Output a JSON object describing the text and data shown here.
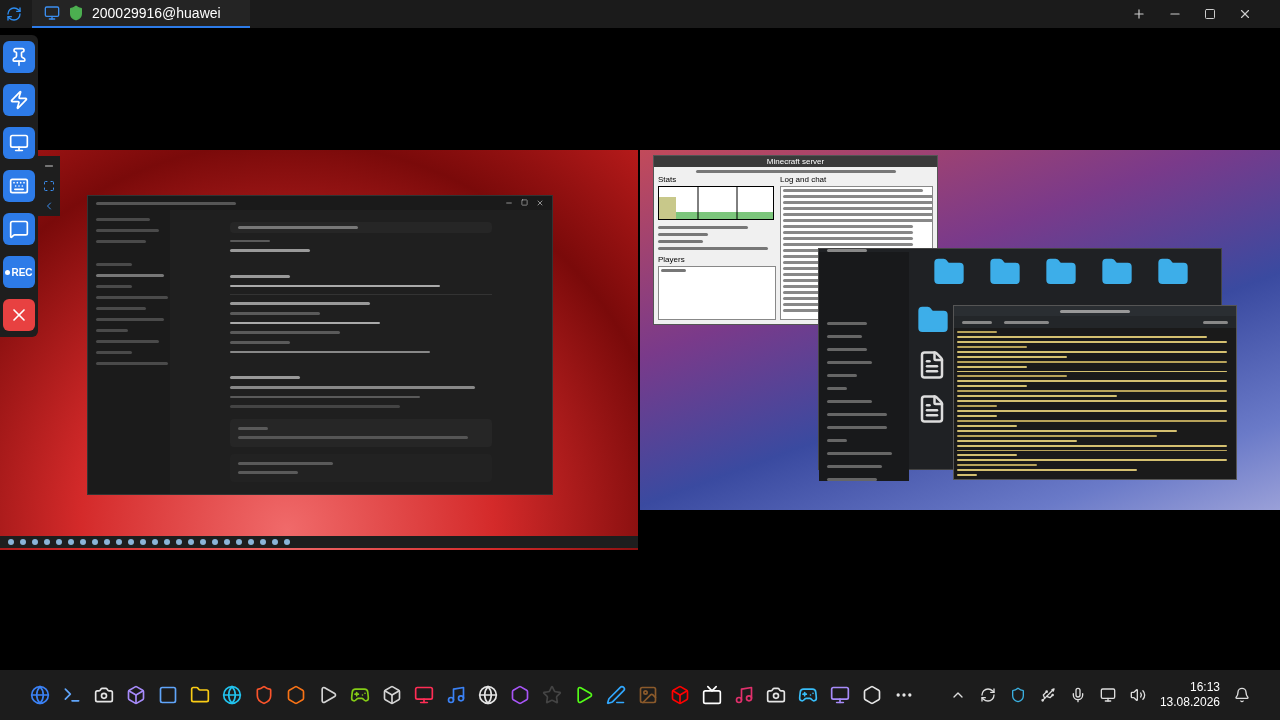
{
  "session_tab": {
    "title": "200029916@huawei",
    "selected": true
  },
  "toolbar": {
    "buttons": [
      {
        "kind": "pin"
      },
      {
        "kind": "bolt"
      },
      {
        "kind": "display"
      },
      {
        "kind": "keyboard"
      },
      {
        "kind": "chat"
      },
      {
        "kind": "record",
        "label": "REC"
      },
      {
        "kind": "close"
      }
    ]
  },
  "server_window": {
    "title": "Minecraft server",
    "stats_label": "Stats",
    "players_label": "Players",
    "log_label": "Log and chat"
  },
  "taskbar": {
    "time": "16:13",
    "date": "13.08.2026"
  }
}
